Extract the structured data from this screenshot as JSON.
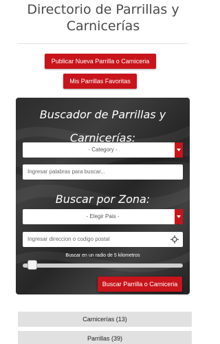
{
  "page": {
    "title_line1": "Directorio de Parrillas y",
    "title_line2": "Carnicerías"
  },
  "actions": {
    "publish_label": "Publicar Nueva Parrilla o Carniceria",
    "favorites_label": "Mis Parrillas Favoritas"
  },
  "search_panel": {
    "heading_line1": "Buscador de Parrillas y",
    "heading_line2": "Carnicerías:",
    "category_select": {
      "selected": "- Category -"
    },
    "keywords_input": {
      "value": "",
      "placeholder": "Ingresar palabras para buscar..."
    },
    "zone_heading": "Buscar por Zona:",
    "country_select": {
      "selected": "- Elegir Pais -"
    },
    "address_input": {
      "value": "",
      "placeholder": "Ingresar direccion o codigo postal"
    },
    "radius_label": "Buscar en un radio de 5 kilometros",
    "radius_slider_fraction": 0.03,
    "search_button_label": "Buscar Parrilla o Carniceria"
  },
  "categories": [
    {
      "label": "Carnicerías (13)"
    },
    {
      "label": "Parrillas (39)"
    }
  ],
  "icons": {
    "locate": "crosshair-icon",
    "dropdown": "chevron-down-icon"
  },
  "colors": {
    "accent": "#c8141b",
    "panel_bg": "#2f2f2f",
    "accordion_bg": "#e1e1e1"
  }
}
